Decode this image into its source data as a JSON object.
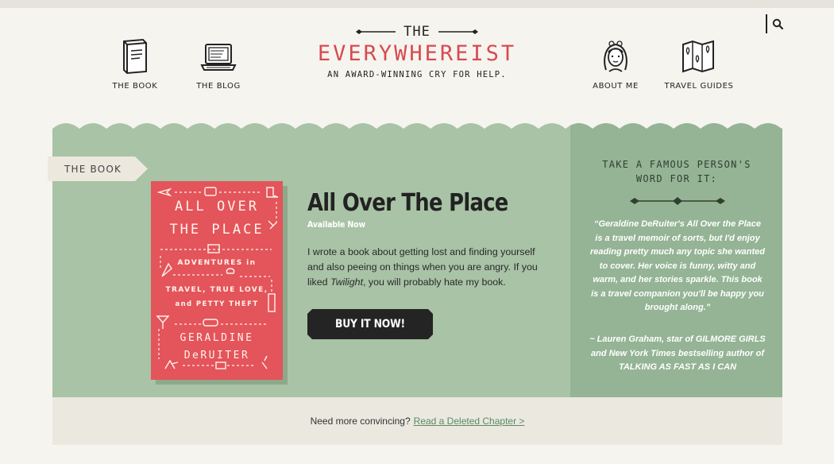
{
  "header": {
    "search_icon": "search-icon",
    "logo": {
      "the": "THE",
      "name": "EVERYWHEREIST",
      "tagline": "AN AWARD-WINNING CRY FOR HELP."
    },
    "nav": [
      {
        "label": "THE BOOK",
        "icon": "book-icon"
      },
      {
        "label": "THE BLOG",
        "icon": "laptop-icon"
      },
      {
        "label": "ABOUT ME",
        "icon": "portrait-icon"
      },
      {
        "label": "TRAVEL GUIDES",
        "icon": "map-icon"
      }
    ]
  },
  "feature": {
    "ribbon": "THE BOOK",
    "cover": {
      "title_line1": "ALL OVER",
      "title_line2": "THE PLACE",
      "subtitle_line1": "ADVENTURES in",
      "subtitle_line2": "TRAVEL, TRUE LOVE,",
      "subtitle_line3": "and PETTY THEFT",
      "author_line1": "GERALDINE",
      "author_line2": "DeRUITER"
    },
    "title": "All Over The Place",
    "availability": "Available Now",
    "description_before": "I wrote a book about getting lost and finding yourself and also peeing on things when you are angry. If you liked ",
    "description_em": "Twilight",
    "description_after": ", you will probably hate my book.",
    "buy_label": "BUY IT NOW!"
  },
  "sidebar": {
    "heading": "TAKE A FAMOUS PERSON'S WORD FOR IT:",
    "quote": "“Geraldine DeRuiter's All Over the Place is a travel memoir of sorts, but I'd enjoy reading pretty much any topic she wanted to cover. Her voice is funny, witty and warm, and her stories sparkle.  This book is a travel companion you'll be happy you brought along.”",
    "citation": "~ Lauren Graham, star of GILMORE GIRLS and New York Times bestselling author of TALKING AS FAST AS I CAN"
  },
  "footer": {
    "prompt": "Need more convincing?",
    "link": "Read a Deleted Chapter >"
  },
  "colors": {
    "logo_red": "#d64b50",
    "panel_green": "#a8c3a5",
    "sidebar_green": "#94b495",
    "cover_red": "#e4545b",
    "button_dark": "#242424",
    "link_green": "#5a8a63"
  }
}
